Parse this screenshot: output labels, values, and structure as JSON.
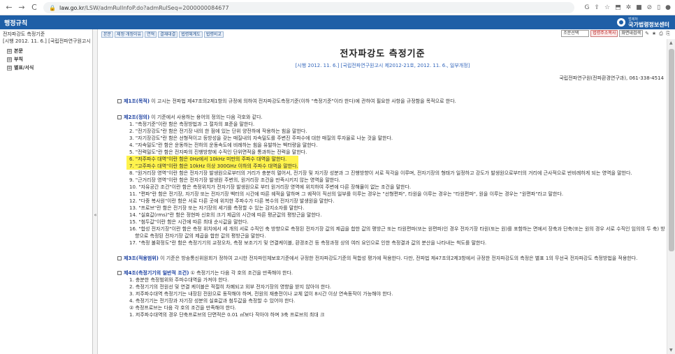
{
  "browser": {
    "url_host": "law.go.kr",
    "url_path": "/LSW/admRulInfoP.do?admRulSeq=2000000084677",
    "nav": {
      "back": "←",
      "forward": "→",
      "reload": "C",
      "home": "⌂"
    },
    "right_icons": [
      "G",
      "⇪",
      "☆",
      "⬒",
      "✲",
      "■",
      "⊘",
      "▯",
      "●"
    ]
  },
  "header": {
    "site_title": "행정규칙",
    "center_logo_small": "법제처",
    "center_logo_big": "국가법령정보센터"
  },
  "left_pane": {
    "title": "전자파강도 측정기준",
    "subtitle": "[시행 2012. 11. 6.] [국립전파연구원고시 제20",
    "tree": [
      {
        "expander": "⊞",
        "label": "본문"
      },
      {
        "expander": "⊞",
        "label": "부칙"
      },
      {
        "expander": "⊞",
        "label": "별표/서식"
      }
    ],
    "splitter_grip": "«"
  },
  "toolbar": {
    "buttons": [
      "본문",
      "제정·개정이유",
      "연혁",
      "결재대결",
      "법령체계도",
      "법령비교"
    ],
    "select_value": "조문선택",
    "btn_red": "법령주소복사",
    "btn_gray": "화면내검색",
    "icons": [
      "✎",
      "★",
      "⎙",
      "⎘"
    ]
  },
  "document": {
    "title": "전자파강도 측정기준",
    "subtitle": "[시행 2012. 11. 6.] [국립전파연구원고시 제2012-21호, 2012. 11. 6., 일부개정]",
    "org": "국립전파연구원(전파환경연구과), 061-338-4514",
    "articles": [
      {
        "title": "제1조(목적)",
        "body": " 이 고시는 전파법 제47조의2제1항의 규정에 의하여 전자파강도측정기준(이하 \"측정기준\"이라 한다)에 관하여 필요한 사항을 규정함을 목적으로 한다.",
        "items": []
      },
      {
        "title": "제2조(정의)",
        "body": " 이 기준에서 사용하는 용어의 정의는 다음 각호와 같다.",
        "items": [
          {
            "text": "1. \"측정기준\"이란 함은 측정방법과 그 절차의 표준을 말한다.",
            "hl": false
          },
          {
            "text": "2. \"전기장강도\"란 함은 전기장 내의 한 점에 있는 단위 양전하에 작용하는 힘을 말한다.",
            "hl": false
          },
          {
            "text": "3. \"자기장강도\"란 함은 선형적이고 등방성을 갖는 매질내의 자속밀도를 주변진 주파수에 대한 매질의 투자율로 나눈 것을 말한다.",
            "hl": false
          },
          {
            "text": "4. \"자속밀도\"란 함은 운동하는 전하의 운동속도에 비례하는 힘을 유발하는 벡터량을 말한다.",
            "hl": false
          },
          {
            "text": "5. \"전력밀도\"란 함은 전자파의 진행방향에 수직인 단위면적을 통과하는 전력을 말한다.",
            "hl": false
          },
          {
            "text": "6. \"저주파수 대역\"이란 함은 0Hz에서 10kHz 미만의 주파수 대역을 말한다.",
            "hl": true
          },
          {
            "text": "7. \"고주파수 대역\"이란 함은 10kHz 이상 300GHz 이하의 주파수 대역을 말한다.",
            "hl": true
          },
          {
            "text": "8. \"원거리장 영역\"이란 함은 전자기장 발생원으로부터의 거리가 충분히 멀어서, 전기장 및 자기장 성분과 그 진행방향이 서로 직각을 이루며, 전자기장의 형태가 일정하고 강도가 발생원으로부터의 거리에 근사적으로 반비례하게 되는 영역을 말한다.",
            "hl": false
          },
          {
            "text": "9. \"근거리장 영역\"이란 함은 전자기장 발생원 주변의, 원거리장 조건을 만족시키지 않는 영역을 말한다.",
            "hl": false
          },
          {
            "text": "10. \"자유공간 조건\"이란 함은 측정위치가 전자기장 발생원으로 부터 원거리장 영역에 위치하여 주변에 다른 장해물이 없는 조건을 말한다.",
            "hl": false
          },
          {
            "text": "11. \"편파\"란 함은 전기장, 자기장 또는 전자기장 벡터의 시간에 따른 궤적을 말하며 그 궤적이 직선의 일부를 이루는 경우는 \"선형편파\", 타원을 이루는 경우는 \"타원편파\", 원을 이루는 경우는 \"원편파\"라고 말한다.",
            "hl": false
          },
          {
            "text": "12. \"다중 복사원\"이란 함은 서로 다른 곳에 위치한 주파수가 다른 복수의 전자기장 발생원을 말한다.",
            "hl": false
          },
          {
            "text": "13. \"프로브\"란 함은 전기장 또는 자기장의 세기를 측정할 수 있는 감지소자를 말한다.",
            "hl": false
          },
          {
            "text": "14. \"실효값(rms)\"란 함은 정현파 신호의 크기 제곱의 시간에 따른 평균값의 평방근을 말한다.",
            "hl": false
          },
          {
            "text": "15. \"첨두값\"이란 함은 시간에 따른 최대 순시값을 말한다.",
            "hl": false
          },
          {
            "text": "16. \"합성 전자기장\"이란 함은 측정 위치에서 세 개의 서로 수직인 축 방향으로 측정된 전자기장 값의 제곱을 합한 값의 평방근 또는 타원편파(또는 원편파)인 경우 전자기장 타원(또는 원)를 포함하는 면에서 장축과 단축(또는 원의 경우 서로 수직인 임의의 두 축) 방",
            "hl": false
          },
          {
            "text": "향으로 측정된 전자기장 값의 제곱을 합한 값의 평방근을 말한다.",
            "hl": false,
            "cont": true
          },
          {
            "text": "17. \"측정 불확정도\"란 함은 측정기기의 교정오차, 측정 보조기기 및 연결케이블, 환경조건 등 측정과정 상의 여러 요인으로 인한 측정결과 값의 분산을 나타내는 척도를 말한다.",
            "hl": false
          }
        ]
      },
      {
        "title": "제3조(적용범위)",
        "body": " 이 기준은 방송통신위원회가 정하여 고시한 전자파인체보호기준에서 규정한 전자파강도기준의 적합성 평가에 적용한다. 다만, 전파법 제47조의2제3항에서 규정한 전자파강도의 측정은 별표 1의 무선국 전자파강도 측정방법을 적용한다.",
        "items": []
      },
      {
        "title": "제4조(측정기기의 일반적 조건)",
        "body": " ① 측정기기는 다음 각 호의 조건을 만족해야 한다.",
        "items": [
          {
            "text": "1. 충분한 측정범위와 주파수대역을 가져야 한다.",
            "hl": false
          },
          {
            "text": "2. 측정기기의 전원선 및 연결 케이블은 적절히 차폐되고 외부 전자기장의 영향을 받지 않아야 한다.",
            "hl": false
          },
          {
            "text": "3. 저주파수대역 측정기기는 내장된 전원으로 동작해야 하며, 전원의 재충전이나 교체 없이 8시간 이상 연속동작이 가능해야 한다.",
            "hl": false
          },
          {
            "text": "4. 측정기기는 전기장과 자기장 성분의 실효값과 첨두값을 측정할 수 있어야 한다.",
            "hl": false
          },
          {
            "text": "② 측정프로브는 다음 각 호의 조건을 만족해야 한다.",
            "hl": false
          },
          {
            "text": "1. 저주파수대역의 경우 단축프로브의 단면적은 0.01 ㎡보다 작아야 하며 3축 프로브의 최대 크",
            "hl": false
          }
        ]
      }
    ]
  }
}
